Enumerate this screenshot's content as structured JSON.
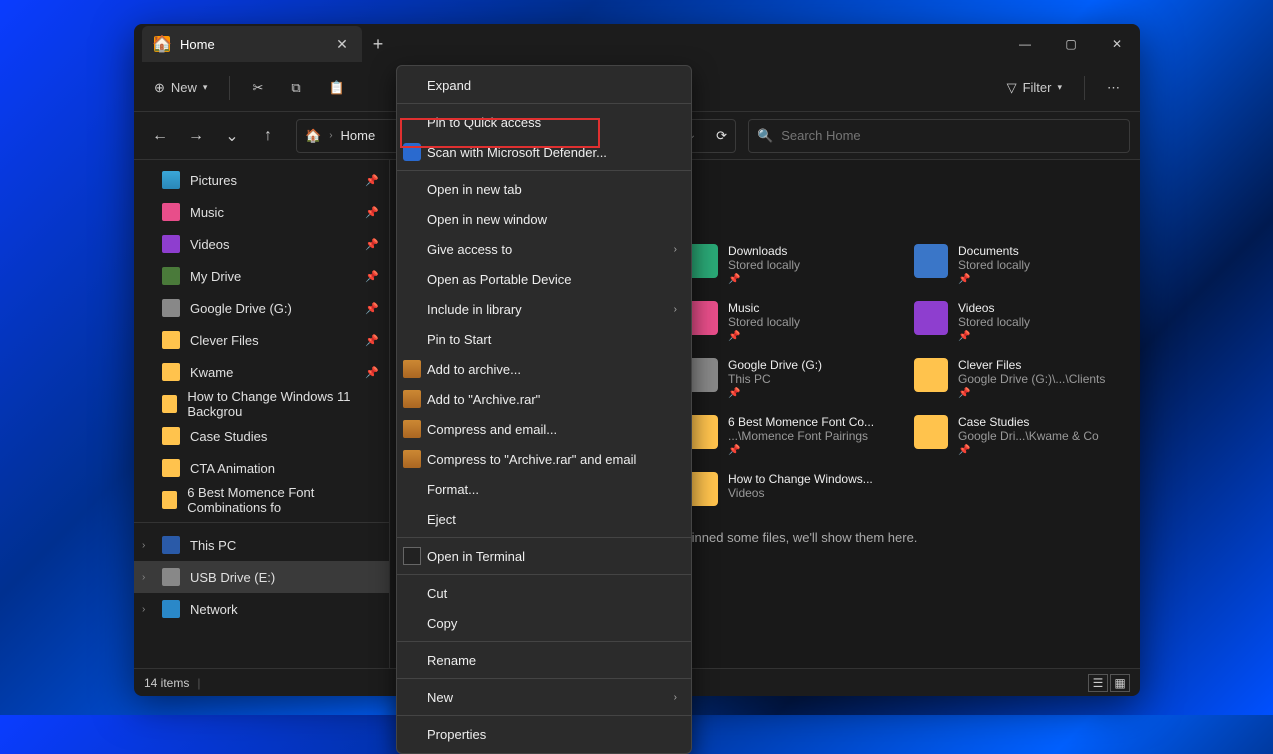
{
  "tab": {
    "title": "Home"
  },
  "toolbar": {
    "new": "New",
    "filter": "Filter"
  },
  "breadcrumb": {
    "current": "Home"
  },
  "search": {
    "placeholder": "Search Home"
  },
  "sidebar": {
    "quick": [
      {
        "label": "Pictures",
        "icon": "ic-pic"
      },
      {
        "label": "Music",
        "icon": "ic-music"
      },
      {
        "label": "Videos",
        "icon": "ic-vid"
      },
      {
        "label": "My Drive",
        "icon": "ic-drive"
      },
      {
        "label": "Google Drive (G:)",
        "icon": "ic-gdrive"
      },
      {
        "label": "Clever Files",
        "icon": "ic-folder"
      },
      {
        "label": "Kwame",
        "icon": "ic-folder"
      },
      {
        "label": "How to Change Windows 11 Backgrou",
        "icon": "ic-folder"
      },
      {
        "label": "Case Studies",
        "icon": "ic-folder"
      },
      {
        "label": "CTA Animation",
        "icon": "ic-folder"
      },
      {
        "label": "6 Best Momence Font Combinations fo",
        "icon": "ic-folder"
      }
    ],
    "nav": [
      {
        "label": "This PC",
        "icon": "ic-pc",
        "selected": false
      },
      {
        "label": "USB Drive (E:)",
        "icon": "ic-usb",
        "selected": true
      },
      {
        "label": "Network",
        "icon": "ic-net",
        "selected": false
      }
    ]
  },
  "items": [
    {
      "name": "Downloads",
      "sub": "Stored locally",
      "icon": "ic-dl",
      "pin": true
    },
    {
      "name": "Documents",
      "sub": "Stored locally",
      "icon": "ic-doc",
      "pin": true
    },
    {
      "name": "Music",
      "sub": "Stored locally",
      "icon": "ic-music",
      "pin": true
    },
    {
      "name": "Videos",
      "sub": "Stored locally",
      "icon": "ic-vid",
      "pin": true
    },
    {
      "name": "Google Drive (G:)",
      "sub": "This PC",
      "icon": "ic-gdrive",
      "pin": true
    },
    {
      "name": "Clever Files",
      "sub": "Google Drive (G:)\\...\\Clients",
      "icon": "ic-folder",
      "pin": true
    },
    {
      "name": "6 Best Momence Font Co...",
      "sub": "...\\Momence Font Pairings",
      "icon": "ic-folder",
      "pin": true
    },
    {
      "name": "Case Studies",
      "sub": "Google Dri...\\Kwame & Co",
      "icon": "ic-folder",
      "pin": true
    },
    {
      "name": "How to Change Windows...",
      "sub": "Videos",
      "icon": "ic-folder",
      "pin": false
    }
  ],
  "hint": "After you've pinned some files, we'll show them here.",
  "status": {
    "count": "14 items"
  },
  "context_menu": [
    {
      "label": "Expand",
      "sep_after": true
    },
    {
      "label": "Pin to Quick access"
    },
    {
      "label": "Scan with Microsoft Defender...",
      "icon": "shield",
      "highlighted": true,
      "sep_after": true
    },
    {
      "label": "Open in new tab"
    },
    {
      "label": "Open in new window"
    },
    {
      "label": "Give access to",
      "sub": true
    },
    {
      "label": "Open as Portable Device"
    },
    {
      "label": "Include in library",
      "sub": true
    },
    {
      "label": "Pin to Start"
    },
    {
      "label": "Add to archive...",
      "icon": "rar"
    },
    {
      "label": "Add to \"Archive.rar\"",
      "icon": "rar"
    },
    {
      "label": "Compress and email...",
      "icon": "rar"
    },
    {
      "label": "Compress to \"Archive.rar\" and email",
      "icon": "rar"
    },
    {
      "label": "Format..."
    },
    {
      "label": "Eject",
      "sep_after": true
    },
    {
      "label": "Open in Terminal",
      "icon": "terminal",
      "sep_after": true
    },
    {
      "label": "Cut"
    },
    {
      "label": "Copy",
      "sep_after": true
    },
    {
      "label": "Rename",
      "sep_after": true
    },
    {
      "label": "New",
      "sub": true,
      "sep_after": true
    },
    {
      "label": "Properties"
    }
  ]
}
